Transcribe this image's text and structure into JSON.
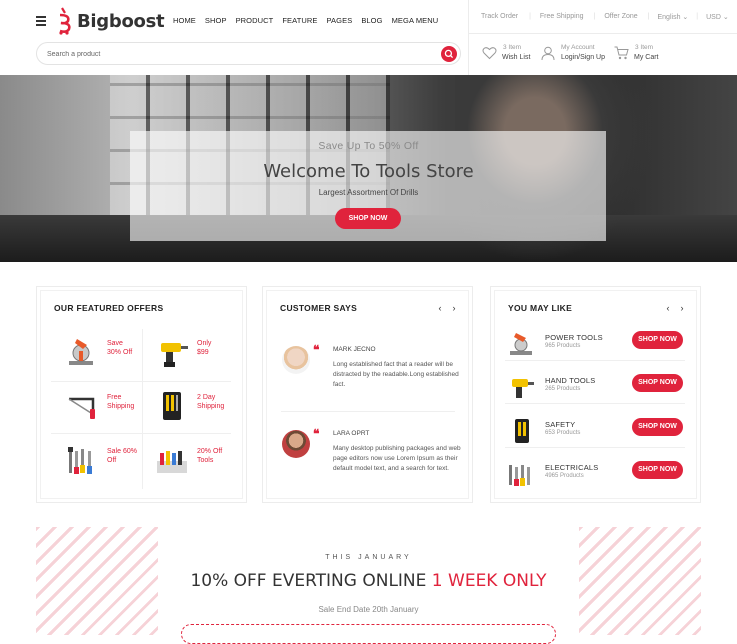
{
  "brand": {
    "name": "Bigboost",
    "accent": "#e0233c"
  },
  "nav": [
    "HOME",
    "SHOP",
    "PRODUCT",
    "FEATURE",
    "PAGES",
    "BLOG",
    "MEGA MENU"
  ],
  "topbar": {
    "track": "Track Order",
    "shipping": "Free Shipping",
    "offer": "Offer Zone",
    "lang": "English",
    "currency": "USD"
  },
  "search": {
    "placeholder": "Search a product"
  },
  "account": {
    "wishlist": {
      "count": "3 Item",
      "label": "Wish List"
    },
    "login": {
      "top": "My Account",
      "label": "Login/Sign Up"
    },
    "cart": {
      "count": "3 Item",
      "label": "My Cart"
    }
  },
  "hero": {
    "subtitle": "Save Up To 50% Off",
    "title": "Welcome To Tools Store",
    "tagline": "Largest Assortment Of Drills",
    "button": "SHOP NOW"
  },
  "featured": {
    "title": "OUR FEATURED OFFERS",
    "offers": [
      {
        "line1": "Save",
        "line2": "30% Off",
        "icon": "miter-saw"
      },
      {
        "line1": "Only",
        "line2": "$99",
        "icon": "drill"
      },
      {
        "line1": "Free",
        "line2": "Shipping",
        "icon": "hacksaw"
      },
      {
        "line1": "2 Day",
        "line2": "Shipping",
        "icon": "tool-set"
      },
      {
        "line1": "Sale 60%",
        "line2": "Off",
        "icon": "hand-tools"
      },
      {
        "line1": "20% Off",
        "line2": "Tools",
        "icon": "tool-kit"
      }
    ]
  },
  "customers": {
    "title": "CUSTOMER SAYS",
    "items": [
      {
        "name": "MARK JECNO",
        "text": "Long established fact that a reader will be distracted by the readable.Long established fact."
      },
      {
        "name": "LARA OPRT",
        "text": "Many desktop publishing packages and web page editors now use Lorem Ipsum as their default model text, and a search for text."
      }
    ]
  },
  "likes": {
    "title": "YOU MAY LIKE",
    "button": "SHOP NOW",
    "items": [
      {
        "name": "POWER TOOLS",
        "count": "965 Products"
      },
      {
        "name": "HAND TOOLS",
        "count": "265 Products"
      },
      {
        "name": "SAFETY",
        "count": "653 Products"
      },
      {
        "name": "ELECTRICALS",
        "count": "4965 Products"
      }
    ]
  },
  "promo": {
    "kicker": "THIS JANUARY",
    "headline_a": "10% OFF EVERTING ONLINE",
    "headline_b": "1 WEEK ONLY",
    "sub": "Sale End Date 20th January"
  }
}
